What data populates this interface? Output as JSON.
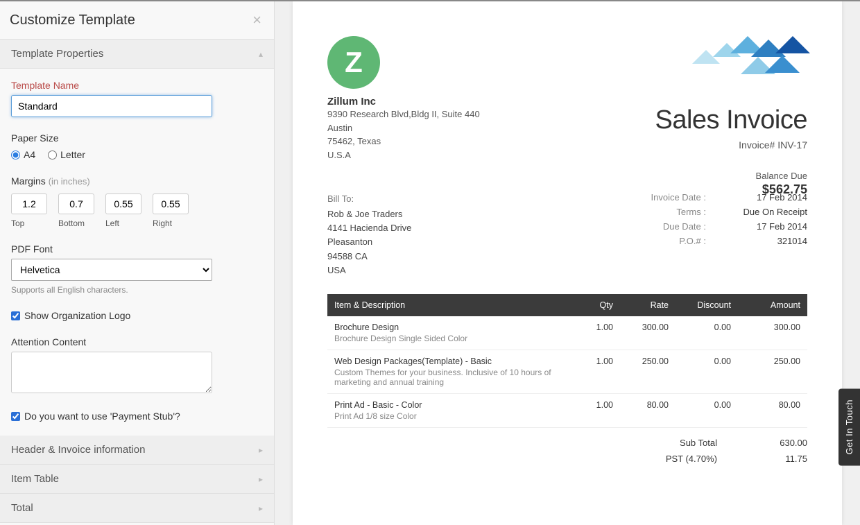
{
  "sidebar": {
    "title": "Customize Template",
    "sections": {
      "props": "Template Properties",
      "header_info": "Header & Invoice information",
      "item_table": "Item Table",
      "total": "Total"
    },
    "template_name_label": "Template Name",
    "template_name_value": "Standard",
    "paper_size_label": "Paper Size",
    "paper_a4": "A4",
    "paper_letter": "Letter",
    "margins_label": "Margins",
    "margins_hint": "(in inches)",
    "margins": {
      "top": "1.2",
      "bottom": "0.7",
      "left": "0.55",
      "right": "0.55"
    },
    "margin_lbls": {
      "top": "Top",
      "bottom": "Bottom",
      "left": "Left",
      "right": "Right"
    },
    "pdf_font_label": "PDF Font",
    "pdf_font_value": "Helvetica",
    "pdf_font_help": "Supports all English characters.",
    "show_logo_label": "Show Organization Logo",
    "attention_label": "Attention Content",
    "payment_stub_label": "Do you want to use 'Payment Stub'?"
  },
  "invoice": {
    "company": {
      "name": "Zillum Inc",
      "addr1": "9390 Research Blvd,Bldg II, Suite 440",
      "city": "Austin",
      "zip_state": "75462, Texas",
      "country": "U.S.A"
    },
    "title": "Sales Invoice",
    "number_label": "Invoice# INV-17",
    "balance_label": "Balance Due",
    "balance_amount": "$562.75",
    "bill_to_label": "Bill To:",
    "bill_to": {
      "name": "Rob & Joe Traders",
      "addr1": "4141 Hacienda Drive",
      "city": "Pleasanton",
      "zip": "94588 CA",
      "country": "USA"
    },
    "meta": {
      "invoice_date_k": "Invoice Date :",
      "invoice_date_v": "17 Feb 2014",
      "terms_k": "Terms :",
      "terms_v": "Due On Receipt",
      "due_date_k": "Due Date :",
      "due_date_v": "17 Feb 2014",
      "po_k": "P.O.# :",
      "po_v": "321014"
    },
    "cols": {
      "desc": "Item & Description",
      "qty": "Qty",
      "rate": "Rate",
      "discount": "Discount",
      "amount": "Amount"
    },
    "items": [
      {
        "name": "Brochure Design",
        "desc": "Brochure Design Single Sided Color",
        "qty": "1.00",
        "rate": "300.00",
        "discount": "0.00",
        "amount": "300.00"
      },
      {
        "name": "Web Design Packages(Template) - Basic",
        "desc": "Custom Themes for your business. Inclusive of 10 hours of marketing and annual training",
        "qty": "1.00",
        "rate": "250.00",
        "discount": "0.00",
        "amount": "250.00"
      },
      {
        "name": "Print Ad - Basic - Color",
        "desc": "Print Ad 1/8 size Color",
        "qty": "1.00",
        "rate": "80.00",
        "discount": "0.00",
        "amount": "80.00"
      }
    ],
    "totals": {
      "subtotal_k": "Sub Total",
      "subtotal_v": "630.00",
      "tax_k": "PST (4.70%)",
      "tax_v": "11.75"
    }
  },
  "get_in_touch": "Get In Touch"
}
